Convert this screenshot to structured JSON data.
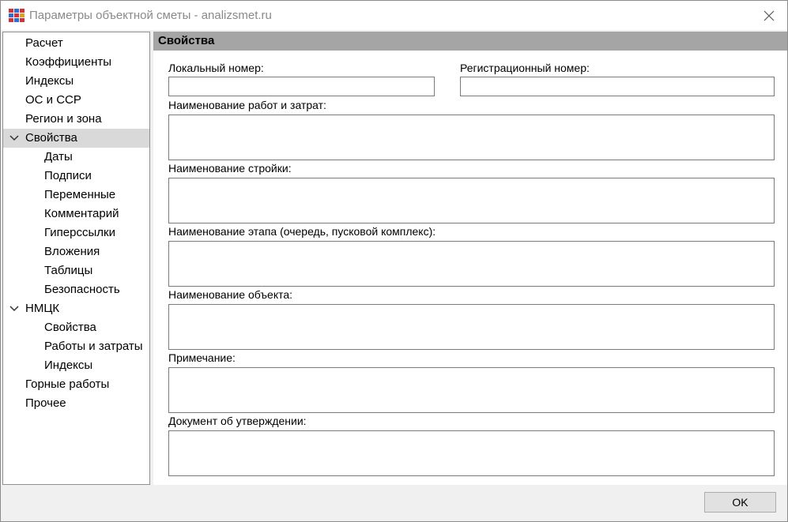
{
  "window": {
    "title": "Параметры объектной сметы - analizsmet.ru"
  },
  "sidebar": {
    "items": [
      {
        "label": "Расчет"
      },
      {
        "label": "Коэффициенты"
      },
      {
        "label": "Индексы"
      },
      {
        "label": "ОС и ССР"
      },
      {
        "label": "Регион и зона"
      },
      {
        "label": "Свойства",
        "expanded": true,
        "selected": true
      },
      {
        "label": "Даты"
      },
      {
        "label": "Подписи"
      },
      {
        "label": "Переменные"
      },
      {
        "label": "Комментарий"
      },
      {
        "label": "Гиперссылки"
      },
      {
        "label": "Вложения"
      },
      {
        "label": "Таблицы"
      },
      {
        "label": "Безопасность"
      },
      {
        "label": "НМЦК",
        "expanded": true
      },
      {
        "label": "Свойства"
      },
      {
        "label": "Работы и затраты"
      },
      {
        "label": "Индексы"
      },
      {
        "label": "Горные работы"
      },
      {
        "label": "Прочее"
      }
    ]
  },
  "panel": {
    "header": "Свойства",
    "fields": {
      "local_number": {
        "label": "Локальный номер:",
        "value": ""
      },
      "reg_number": {
        "label": "Регистрационный номер:",
        "value": ""
      },
      "work_name": {
        "label": "Наименование работ и затрат:",
        "value": ""
      },
      "construction_name": {
        "label": "Наименование стройки:",
        "value": ""
      },
      "stage_name": {
        "label": "Наименование этапа (очередь, пусковой комплекс):",
        "value": ""
      },
      "object_name": {
        "label": "Наименование объекта:",
        "value": ""
      },
      "note": {
        "label": "Примечание:",
        "value": ""
      },
      "approval_doc": {
        "label": "Документ об утверждении:",
        "value": ""
      }
    }
  },
  "footer": {
    "ok_label": "OK"
  },
  "colors": {
    "panel_header_bg": "#a5a5a5",
    "selected_item_bg": "#d9d9d9",
    "title_text": "#8a8a8a"
  }
}
